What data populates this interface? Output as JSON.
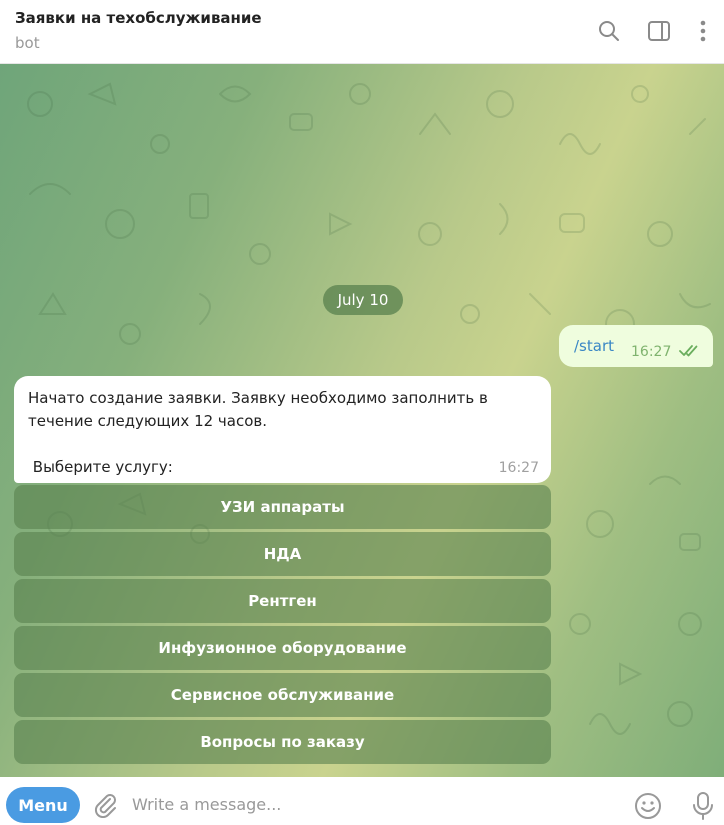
{
  "header": {
    "title": "Заявки на техобслуживание",
    "subtitle": "bot",
    "icons": [
      "search-icon",
      "sidebar-toggle-icon",
      "more-vertical-icon"
    ]
  },
  "chat": {
    "date_label": "July 10",
    "outgoing": {
      "text": "/start",
      "time": "16:27",
      "status": "read"
    },
    "incoming": {
      "text": "Начато создание заявки. Заявку необходимо заполнить в течение следующих 12 часов.\n\n Выберите услугу:",
      "time": "16:27"
    },
    "keyboard": [
      "УЗИ аппараты",
      "НДА",
      "Рентген",
      "Инфузионное оборудование",
      "Сервисное обслуживание",
      "Вопросы по заказу"
    ]
  },
  "input": {
    "menu_label": "Menu",
    "placeholder": "Write a message..."
  },
  "colors": {
    "accent": "#4a9be2",
    "outgoing_bubble": "#effdde",
    "keyboard_button": "#58804e"
  }
}
